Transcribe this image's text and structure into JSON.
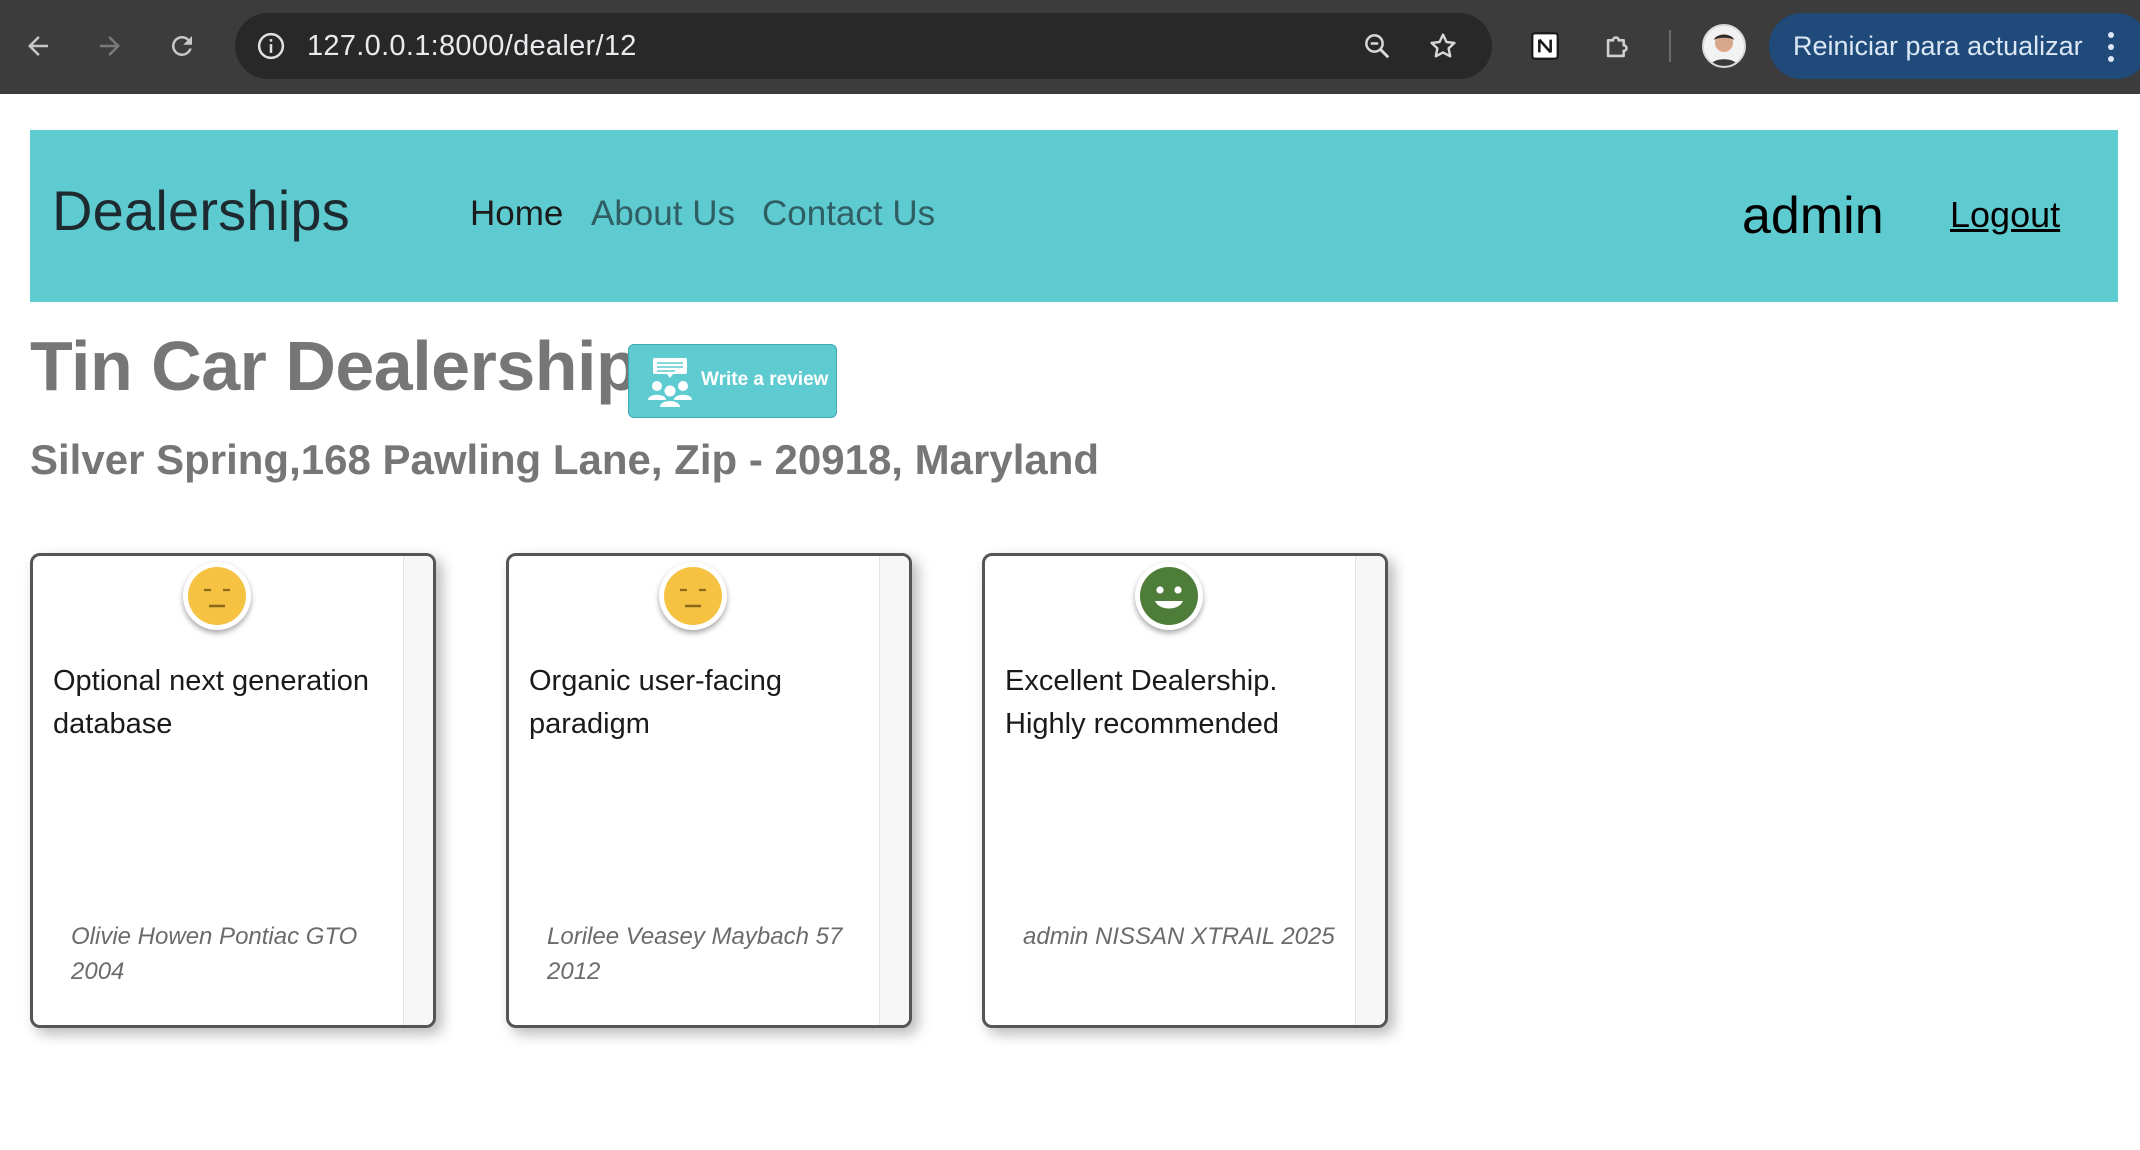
{
  "browser": {
    "url": "127.0.0.1:8000/dealer/12",
    "update_label": "Reiniciar para actualizar"
  },
  "navbar": {
    "brand": "Dealerships",
    "links": [
      "Home",
      "About Us",
      "Contact Us"
    ],
    "user": "admin",
    "logout": "Logout"
  },
  "dealer": {
    "name": "Tin Car Dealership",
    "write_review_label": "Write a review",
    "address": "Silver Spring,168 Pawling Lane, Zip - 20918, Maryland"
  },
  "reviews": [
    {
      "sentiment": "neutral",
      "text": "Optional next generation database",
      "reviewer": "Olivie Howen Pontiac GTO 2004",
      "color": "#f5c242"
    },
    {
      "sentiment": "neutral",
      "text": "Organic user-facing paradigm",
      "reviewer": "Lorilee Veasey Maybach 57 2012",
      "color": "#f5c242"
    },
    {
      "sentiment": "positive",
      "text": "Excellent Dealership. Highly recommended",
      "reviewer": "admin NISSAN XTRAIL 2025",
      "color": "#4e7d3a"
    }
  ],
  "colors": {
    "navbar_bg": "#5ecbd1",
    "heading_text": "#767676",
    "chrome_bg": "#3c3c3c",
    "update_btn_bg": "#1f4a7a"
  }
}
